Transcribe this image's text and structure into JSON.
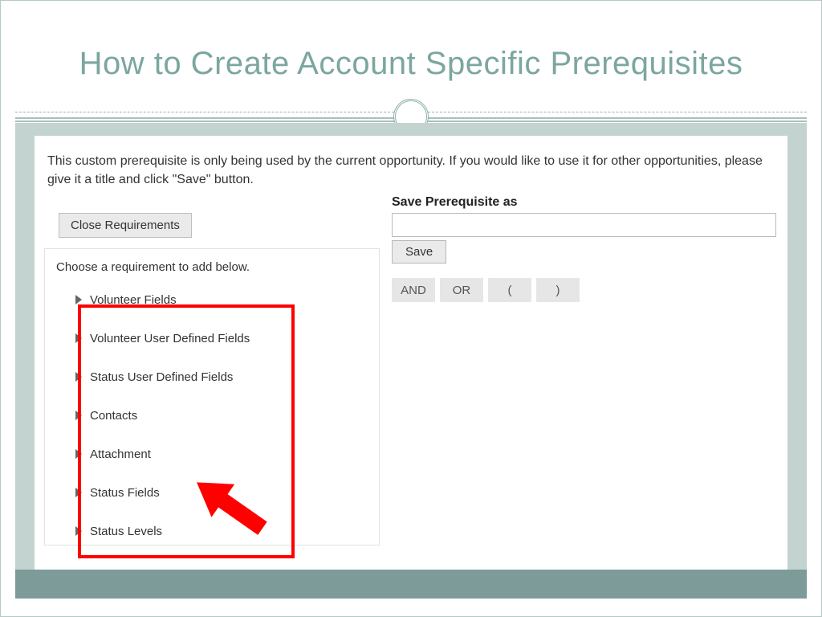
{
  "title": "How to Create Account Specific Prerequisites",
  "instruction": "This custom prerequisite is only being used by the current opportunity. If you would like to use it for other opportunities, please give it a title and click \"Save\" button.",
  "buttons": {
    "close": "Close Requirements",
    "save": "Save"
  },
  "requirement_panel": {
    "heading": "Choose a requirement to add below.",
    "items": [
      "Volunteer Fields",
      "Volunteer User Defined Fields",
      "Status User Defined Fields",
      "Contacts",
      "Attachment",
      "Status Fields",
      "Status Levels"
    ]
  },
  "save_as": {
    "label": "Save Prerequisite as",
    "value": ""
  },
  "logic": {
    "and": "AND",
    "or": "OR",
    "open_paren": "(",
    "close_paren": ")"
  }
}
